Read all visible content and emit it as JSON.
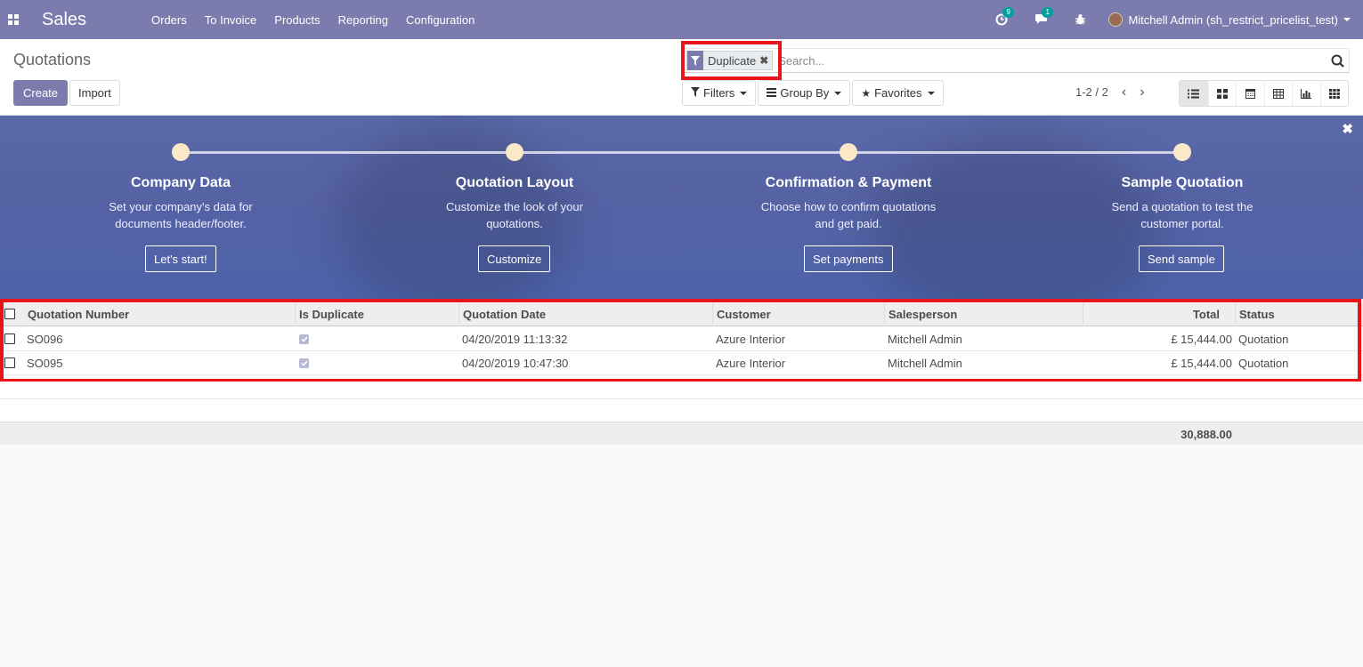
{
  "navbar": {
    "brand": "Sales",
    "menu": [
      "Orders",
      "To Invoice",
      "Products",
      "Reporting",
      "Configuration"
    ],
    "activity_count": "9",
    "message_count": "1",
    "user_name": "Mitchell Admin (sh_restrict_pricelist_test)"
  },
  "control": {
    "title": "Quotations",
    "create_label": "Create",
    "import_label": "Import",
    "facet_value": "Duplicate",
    "search_placeholder": "Search...",
    "filters_label": "Filters",
    "groupby_label": "Group By",
    "favorites_label": "Favorites",
    "pager": "1-2 / 2"
  },
  "banner": {
    "steps": [
      {
        "title": "Company Data",
        "desc1": "Set your company's data for",
        "desc2": "documents header/footer.",
        "button": "Let's start!"
      },
      {
        "title": "Quotation Layout",
        "desc1": "Customize the look of your",
        "desc2": "quotations.",
        "button": "Customize"
      },
      {
        "title": "Confirmation & Payment",
        "desc1": "Choose how to confirm quotations",
        "desc2": "and get paid.",
        "button": "Set payments"
      },
      {
        "title": "Sample Quotation",
        "desc1": "Send a quotation to test the",
        "desc2": "customer portal.",
        "button": "Send sample"
      }
    ]
  },
  "table": {
    "columns": [
      "Quotation Number",
      "Is Duplicate",
      "Quotation Date",
      "Customer",
      "Salesperson",
      "Total",
      "Status"
    ],
    "rows": [
      {
        "number": "SO096",
        "is_duplicate": true,
        "date": "04/20/2019 11:13:32",
        "customer": "Azure Interior",
        "salesperson": "Mitchell Admin",
        "total": "£ 15,444.00",
        "status": "Quotation"
      },
      {
        "number": "SO095",
        "is_duplicate": true,
        "date": "04/20/2019 10:47:30",
        "customer": "Azure Interior",
        "salesperson": "Mitchell Admin",
        "total": "£ 15,444.00",
        "status": "Quotation"
      }
    ],
    "footer_total": "30,888.00"
  },
  "colors": {
    "brand": "#7c7bad",
    "highlight": "#e8141a",
    "badge": "#00a09d"
  }
}
